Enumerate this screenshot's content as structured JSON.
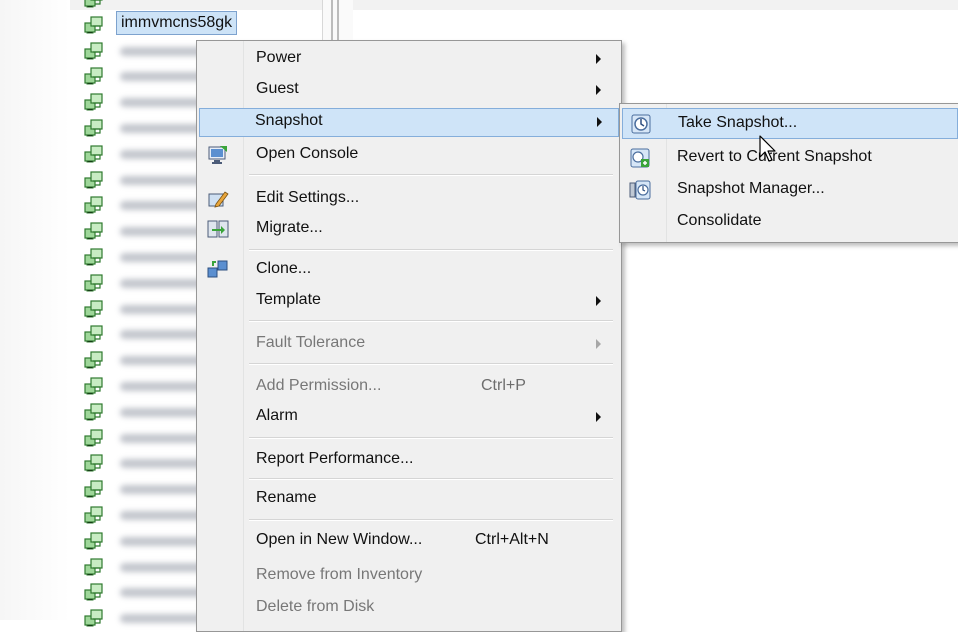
{
  "tree": {
    "selected_vm": "immvmcns58gk"
  },
  "context_menu": {
    "items": [
      {
        "label": "Power",
        "submenu": true
      },
      {
        "label": "Guest",
        "submenu": true
      },
      {
        "label": "Snapshot",
        "submenu": true,
        "highlighted": true
      },
      {
        "label": "Open Console",
        "icon": "console-icon"
      },
      {
        "label": "Edit Settings...",
        "icon": "edit-settings-icon"
      },
      {
        "label": "Migrate...",
        "icon": "migrate-icon"
      },
      {
        "label": "Clone...",
        "icon": "clone-icon"
      },
      {
        "label": "Template",
        "submenu": true
      },
      {
        "label": "Fault Tolerance",
        "submenu": true,
        "disabled": true
      },
      {
        "label": "Add Permission...",
        "shortcut": "Ctrl+P",
        "disabled": true
      },
      {
        "label": "Alarm",
        "submenu": true
      },
      {
        "label": "Report Performance..."
      },
      {
        "label": "Rename"
      },
      {
        "label": "Open in New Window...",
        "shortcut": "Ctrl+Alt+N"
      },
      {
        "label": "Remove from Inventory",
        "disabled": true
      },
      {
        "label": "Delete from Disk",
        "disabled": true
      }
    ]
  },
  "snapshot_submenu": {
    "items": [
      {
        "label": "Take Snapshot...",
        "icon": "take-snapshot-icon",
        "highlighted": true
      },
      {
        "label": "Revert to Current Snapshot",
        "icon": "revert-snapshot-icon"
      },
      {
        "label": "Snapshot Manager...",
        "icon": "snapshot-manager-icon"
      },
      {
        "label": "Consolidate"
      }
    ]
  },
  "colors": {
    "menu_bg": "#f0f0f0",
    "highlight_bg": "#cfe4f8",
    "highlight_border": "#85aedb",
    "vm_icon_green": "#3aa43a"
  }
}
